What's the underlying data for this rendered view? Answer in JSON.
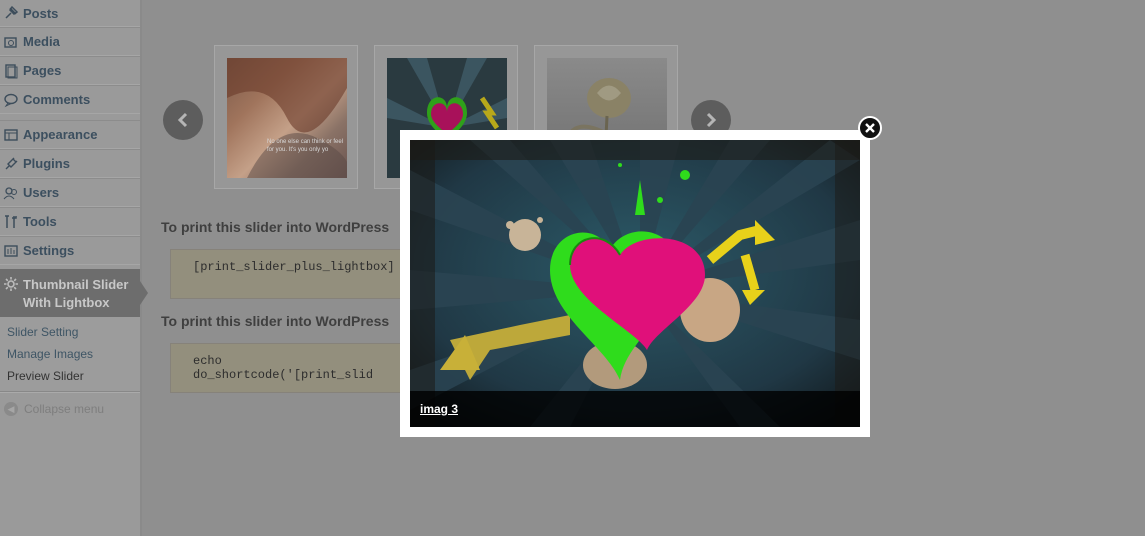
{
  "sidebar": {
    "items": [
      {
        "label": "Posts",
        "icon": "pin-icon"
      },
      {
        "label": "Media",
        "icon": "media-icon"
      },
      {
        "label": "Pages",
        "icon": "pages-icon"
      },
      {
        "label": "Comments",
        "icon": "comments-icon"
      },
      {
        "label": "Appearance",
        "icon": "appearance-icon"
      },
      {
        "label": "Plugins",
        "icon": "plugins-icon"
      },
      {
        "label": "Users",
        "icon": "users-icon"
      },
      {
        "label": "Tools",
        "icon": "tools-icon"
      },
      {
        "label": "Settings",
        "icon": "settings-icon"
      }
    ],
    "active": {
      "label": "Thumbnail Slider With Lightbox",
      "icon": "gear-icon"
    },
    "submenu": [
      "Slider Setting",
      "Manage Images",
      "Preview Slider"
    ],
    "collapse_label": "Collapse menu"
  },
  "content": {
    "thumbnail_text": "No one else can think or feel for you. It's you only yo",
    "heading1": "To print this slider into WordPress",
    "code1": "[print_slider_plus_lightbox]",
    "heading2": "To print this slider into WordPress",
    "code2": "echo do_shortcode('[print_slid"
  },
  "lightbox": {
    "caption": "imag 3"
  },
  "colors": {
    "overlay": "#8f8f8f",
    "lightbox_frame": "#ffffff",
    "heart_pink": "#e0107a",
    "heart_green": "#2fdc1c",
    "arrow_yellow": "#e8d11a"
  }
}
